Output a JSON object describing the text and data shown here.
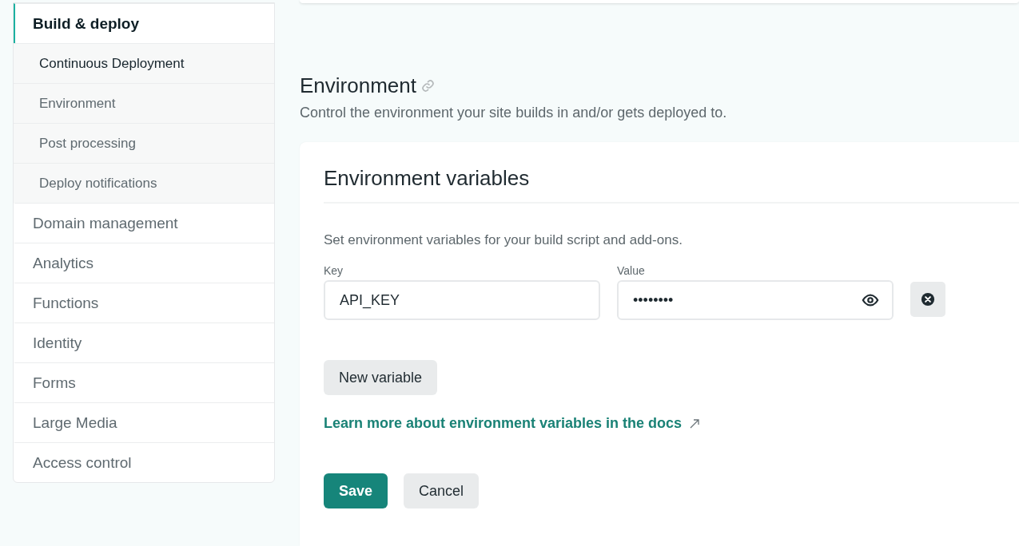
{
  "sidebar": {
    "items": [
      {
        "label": "Build & deploy",
        "selected": true,
        "children": [
          {
            "label": "Continuous Deployment",
            "selected": true
          },
          {
            "label": "Environment",
            "selected": false
          },
          {
            "label": "Post processing",
            "selected": false
          },
          {
            "label": "Deploy notifications",
            "selected": false
          }
        ]
      },
      {
        "label": "Domain management",
        "selected": false
      },
      {
        "label": "Analytics",
        "selected": false
      },
      {
        "label": "Functions",
        "selected": false
      },
      {
        "label": "Identity",
        "selected": false
      },
      {
        "label": "Forms",
        "selected": false
      },
      {
        "label": "Large Media",
        "selected": false
      },
      {
        "label": "Access control",
        "selected": false
      }
    ]
  },
  "section": {
    "title": "Environment",
    "description": "Control the environment your site builds in and/or gets deployed to."
  },
  "card": {
    "title": "Environment variables",
    "description": "Set environment variables for your build script and add-ons.",
    "variables": [
      {
        "key_label": "Key",
        "key": "API_KEY",
        "value_label": "Value",
        "value": "••••••••"
      }
    ],
    "new_button": "New variable",
    "docs_link": "Learn more about environment variables in the docs",
    "save_button": "Save",
    "cancel_button": "Cancel"
  }
}
